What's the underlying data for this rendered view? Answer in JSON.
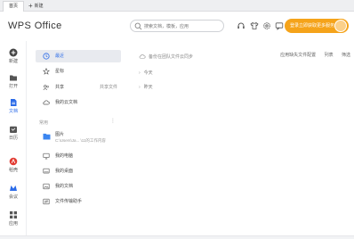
{
  "tabs": {
    "home": "首页",
    "new": "新建"
  },
  "header": {
    "logo": "WPS Office",
    "search_placeholder": "搜索文档，模板，应用",
    "login_button": "登录立即获取更多服务",
    "accent": "#f5a31a"
  },
  "rail": [
    {
      "label": "新建",
      "icon": "plus-circle-icon"
    },
    {
      "label": "打开",
      "icon": "folder-icon"
    },
    {
      "label": "文档",
      "icon": "document-icon"
    },
    {
      "label": "日历",
      "icon": "calendar-icon"
    },
    {
      "label": "稻壳",
      "icon": "daoke-icon"
    },
    {
      "label": "会议",
      "icon": "meeting-icon"
    },
    {
      "label": "应用",
      "icon": "apps-grid-icon"
    }
  ],
  "nav": {
    "items": [
      {
        "label": "最近",
        "icon": "clock-icon"
      },
      {
        "label": "星标",
        "icon": "star-icon"
      },
      {
        "label": "共享",
        "icon": "share-icon",
        "right": "共享文件"
      },
      {
        "label": "我的云文档",
        "icon": "cloud-icon"
      }
    ],
    "section_label": "常用",
    "folders": [
      {
        "label": "图片",
        "sub": "C:\\Users\\Ja... \\11的工作内容"
      },
      {
        "label": "我的电脑"
      },
      {
        "label": "我的桌面"
      },
      {
        "label": "我的文档"
      },
      {
        "label": "文件传输助手"
      }
    ]
  },
  "main": {
    "sync_text": "备份在团队文件云同步",
    "toolbar": [
      "应用缺失文件配置",
      "列表",
      "筛选"
    ],
    "groups": [
      "今天",
      "昨天"
    ]
  }
}
